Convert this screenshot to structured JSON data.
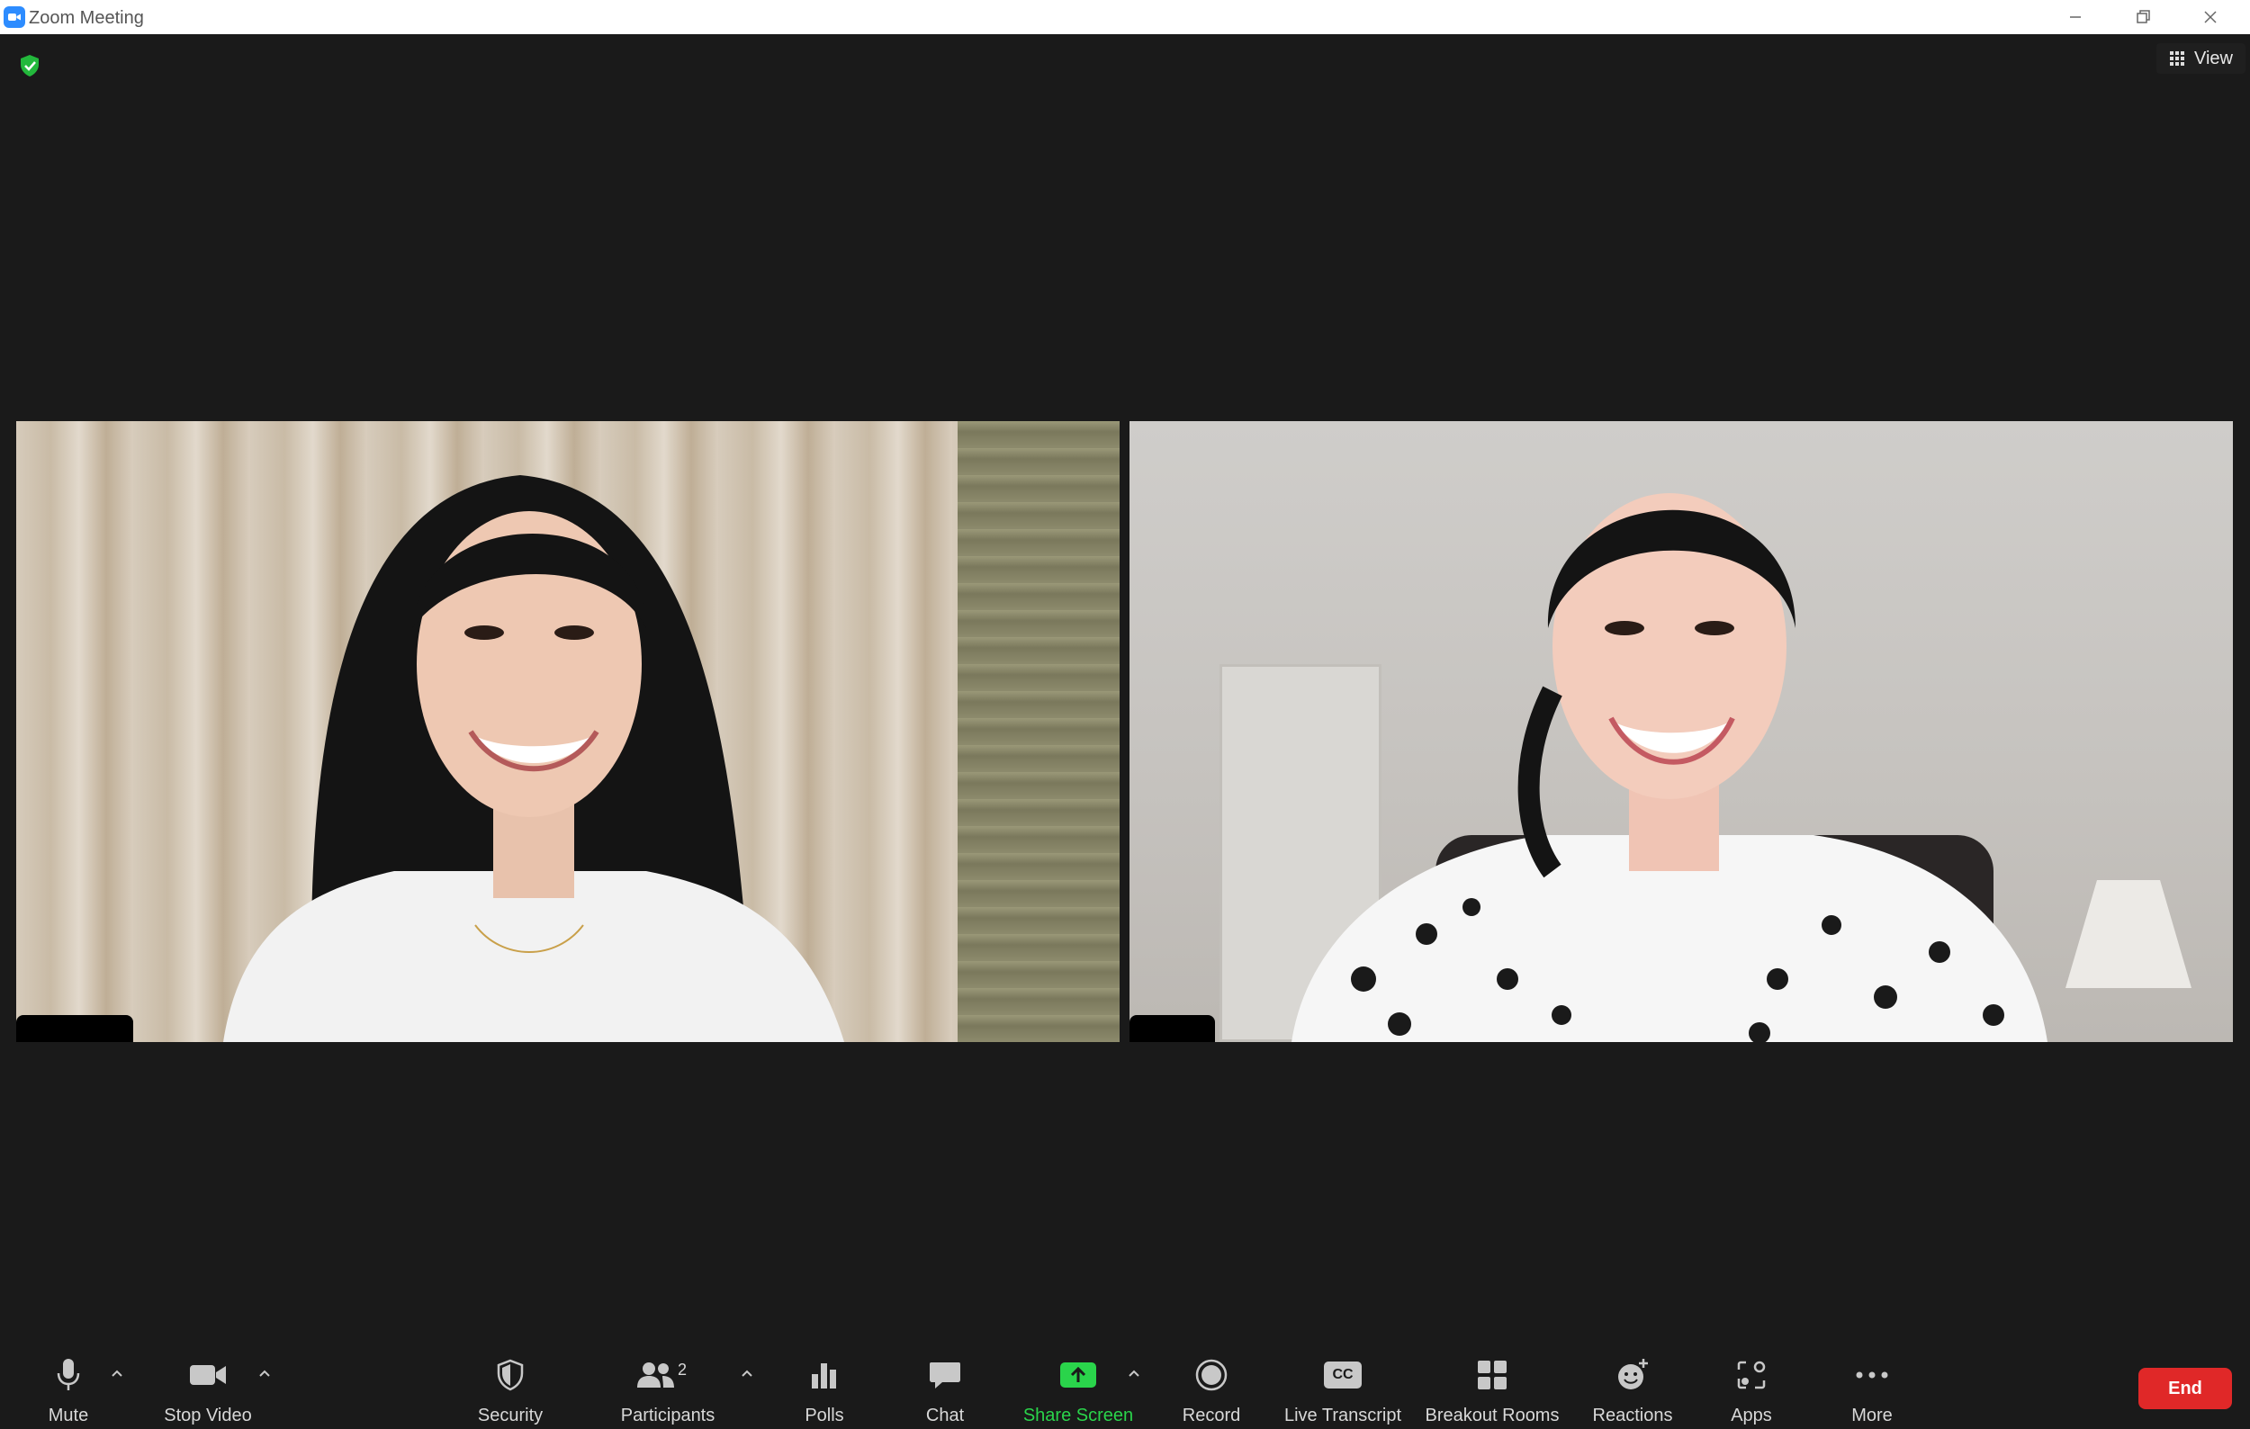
{
  "window": {
    "title": "Zoom Meeting"
  },
  "top_bar": {
    "view_label": "View"
  },
  "toolbar": {
    "mute_label": "Mute",
    "stop_video_label": "Stop Video",
    "security_label": "Security",
    "participants_label": "Participants",
    "participants_count": "2",
    "polls_label": "Polls",
    "chat_label": "Chat",
    "share_screen_label": "Share Screen",
    "record_label": "Record",
    "live_transcript_label": "Live Transcript",
    "live_transcript_badge": "CC",
    "breakout_rooms_label": "Breakout Rooms",
    "reactions_label": "Reactions",
    "apps_label": "Apps",
    "more_label": "More",
    "end_label": "End"
  },
  "colors": {
    "background": "#1a1a1a",
    "accent_green": "#2ad44b",
    "end_red": "#e02828",
    "zoom_blue": "#2d8cff"
  },
  "icons": {
    "app": "zoom-camera-icon",
    "security_status": "shield-check-icon",
    "view": "grid-icon"
  }
}
